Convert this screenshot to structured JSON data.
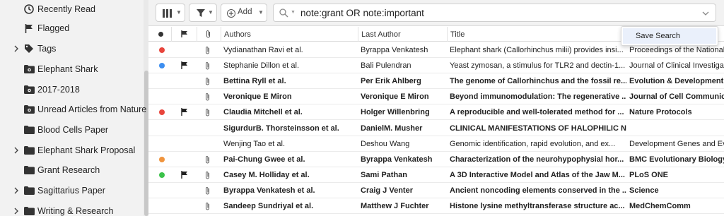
{
  "sidebar": {
    "items": [
      {
        "label": "Recently Read",
        "icon": "clock-icon",
        "expandable": false
      },
      {
        "label": "Flagged",
        "icon": "flag-icon",
        "expandable": false
      },
      {
        "label": "Tags",
        "icon": "tag-icon",
        "expandable": true
      },
      {
        "label": "Elephant Shark",
        "icon": "smart-folder-icon",
        "expandable": false
      },
      {
        "label": "2017-2018",
        "icon": "smart-folder-icon",
        "expandable": false
      },
      {
        "label": "Unread Articles from Nature",
        "icon": "smart-folder-icon",
        "expandable": false
      },
      {
        "label": "Blood Cells Paper",
        "icon": "folder-icon",
        "expandable": false
      },
      {
        "label": "Elephant Shark Proposal",
        "icon": "folder-icon",
        "expandable": true
      },
      {
        "label": "Grant Research",
        "icon": "folder-icon",
        "expandable": false
      },
      {
        "label": "Sagittarius Paper",
        "icon": "folder-icon",
        "expandable": true
      },
      {
        "label": "Writing & Research",
        "icon": "folder-icon",
        "expandable": true
      }
    ]
  },
  "toolbar": {
    "add_label": "Add",
    "search_value": "note:grant OR note:important"
  },
  "table": {
    "headers": {
      "authors": "Authors",
      "last_author": "Last Author",
      "title": "Title"
    },
    "rows": [
      {
        "authors": "Vydianathan Ravi et al.",
        "last_author": "Byrappa Venkatesh",
        "title": "Elephant shark (Callorhinchus milii) provides insi...",
        "journal": "Proceedings of the National",
        "color": "#e8453c",
        "flag": false,
        "attachment": true,
        "unread": false
      },
      {
        "authors": "Stephanie Dillon et al.",
        "last_author": "Bali Pulendran",
        "title": "Yeast zymosan, a stimulus for TLR2 and dectin-1...",
        "journal": "Journal of Clinical Investigat",
        "color": "#3d8ef0",
        "flag": true,
        "attachment": true,
        "unread": false
      },
      {
        "authors": "Bettina Ryll et al.",
        "last_author": "Per Erik Ahlberg",
        "title": "The genome of Callorhinchus and the fossil re...",
        "journal": "Evolution & Development",
        "color": "",
        "flag": false,
        "attachment": true,
        "unread": true
      },
      {
        "authors": "Veronique E Miron",
        "last_author": "Veronique E Miron",
        "title": "Beyond immunomodulation: The regenerative ...",
        "journal": "Journal of Cell Communica",
        "color": "",
        "flag": false,
        "attachment": true,
        "unread": true
      },
      {
        "authors": "Claudia Mitchell et al.",
        "last_author": "Holger Willenbring",
        "title": "A reproducible and well-tolerated method for ...",
        "journal": "Nature Protocols",
        "color": "#e8453c",
        "flag": true,
        "attachment": true,
        "unread": true
      },
      {
        "authors": "SigurdurB. Thorsteinsson et al.",
        "last_author": "DanielM. Musher",
        "title": "CLINICAL MANIFESTATIONS OF HALOPHILIC N...",
        "journal": "",
        "color": "",
        "flag": false,
        "attachment": false,
        "unread": true
      },
      {
        "authors": "Wenjing Tao et al.",
        "last_author": "Deshou Wang",
        "title": "Genomic identification, rapid evolution, and ex...",
        "journal": "Development Genes and Ev",
        "color": "",
        "flag": false,
        "attachment": false,
        "unread": false
      },
      {
        "authors": "Pai-Chung Gwee et al.",
        "last_author": "Byrappa Venkatesh",
        "title": "Characterization of the neurohypophysial hor...",
        "journal": "BMC Evolutionary Biology",
        "color": "#f0943d",
        "flag": false,
        "attachment": true,
        "unread": true
      },
      {
        "authors": "Casey M. Holliday et al.",
        "last_author": "Sami Pathan",
        "title": "A 3D Interactive Model and Atlas of the Jaw M...",
        "journal": "PLoS ONE",
        "color": "#3cc24a",
        "flag": true,
        "attachment": true,
        "unread": true
      },
      {
        "authors": "Byrappa Venkatesh et al.",
        "last_author": "Craig J Venter",
        "title": "Ancient noncoding elements conserved in the ...",
        "journal": "Science",
        "color": "",
        "flag": false,
        "attachment": true,
        "unread": true
      },
      {
        "authors": "Sandeep Sundriyal et al.",
        "last_author": "Matthew J Fuchter",
        "title": "Histone lysine methyltransferase structure ac...",
        "journal": "MedChemComm",
        "color": "",
        "flag": false,
        "attachment": true,
        "unread": true
      }
    ]
  },
  "menu": {
    "save_search_label": "Save Search"
  }
}
